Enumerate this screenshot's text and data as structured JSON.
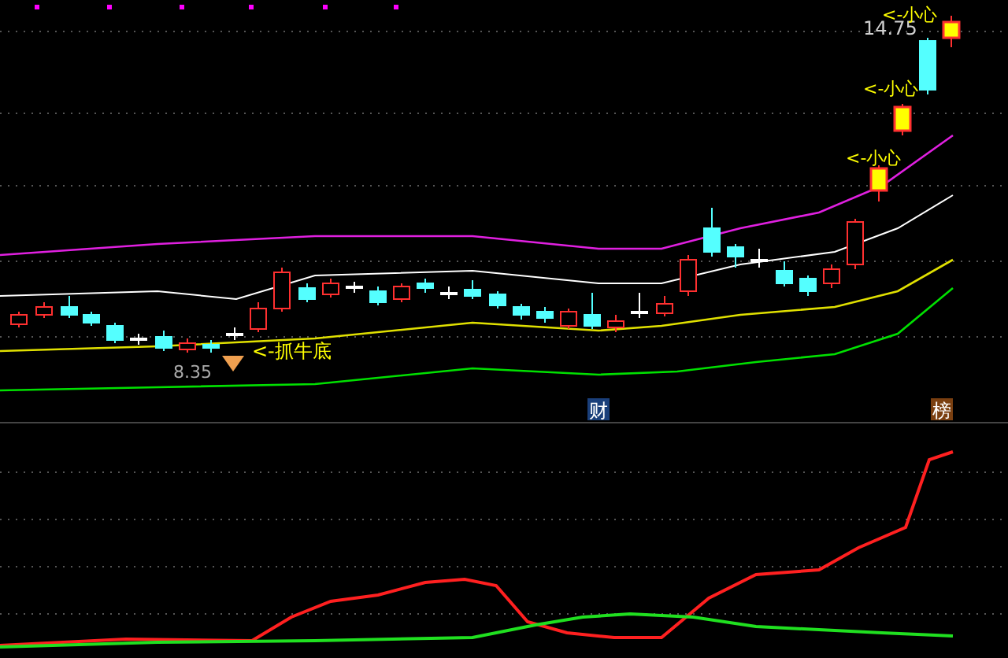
{
  "main_chart": {
    "price_label": "14.75",
    "warnings": [
      "<-小心",
      "<-小心",
      "<-小心"
    ],
    "low_price": "8.35",
    "low_signal": "<-抓牛底"
  },
  "badges": [
    {
      "text": "财",
      "color": "#1a3f7a"
    },
    {
      "text": "榜",
      "color": "#7a3f10"
    }
  ]
}
